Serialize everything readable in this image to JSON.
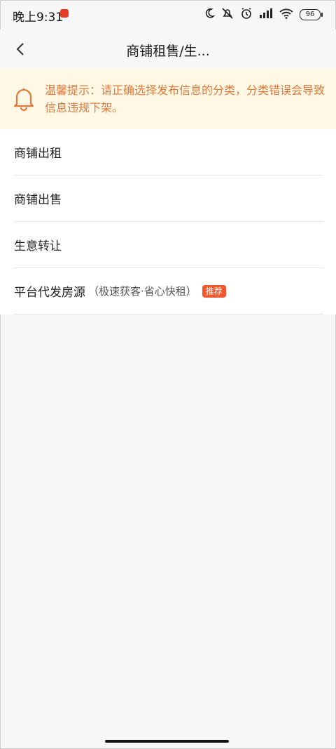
{
  "status_bar": {
    "time": "晚上9:31",
    "battery": "96"
  },
  "nav": {
    "title": "商铺租售/生..."
  },
  "tip": {
    "text": "温馨提示：请正确选择发布信息的分类，分类错误会导致信息违规下架。"
  },
  "list": {
    "items": [
      {
        "label": "商铺出租"
      },
      {
        "label": "商铺出售"
      },
      {
        "label": "生意转让"
      },
      {
        "label": "平台代发房源",
        "sub": "（极速获客·省心快租）",
        "badge": "推荐"
      }
    ]
  },
  "colors": {
    "tip_background": "#fff8e5",
    "tip_text": "#e0793a",
    "badge": "#f2562d"
  }
}
